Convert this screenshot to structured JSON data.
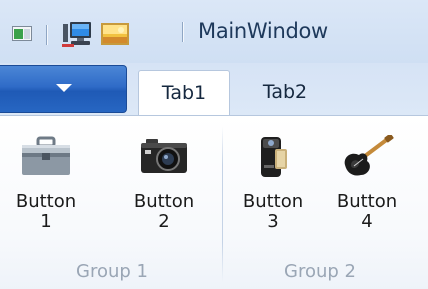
{
  "window": {
    "title": "MainWindow"
  },
  "quick_access": {
    "items": [
      "computer-icon",
      "picture-icon"
    ]
  },
  "ribbon": {
    "app_menu": {
      "icon": "chevron-down-icon"
    },
    "tabs": [
      {
        "label": "Tab1",
        "selected": true
      },
      {
        "label": "Tab2",
        "selected": false
      }
    ],
    "groups": [
      {
        "label": "Group 1",
        "buttons": [
          {
            "label": "Button\n1",
            "icon": "toolbox-icon"
          },
          {
            "label": "Button\n2",
            "icon": "camera-icon"
          }
        ]
      },
      {
        "label": "Group 2",
        "buttons": [
          {
            "label": "Button\n3",
            "icon": "camcorder-icon"
          },
          {
            "label": "Button\n4",
            "icon": "guitar-icon"
          }
        ]
      }
    ]
  },
  "colors": {
    "accent": "#2f6bc7",
    "title_text": "#1e395b",
    "group_label": "#9aa6b5"
  }
}
